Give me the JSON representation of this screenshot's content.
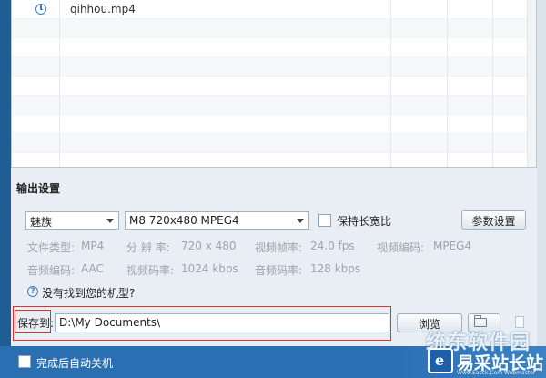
{
  "file_list": {
    "files": [
      {
        "name": "qihhou.mp4",
        "icon": "clock-icon"
      }
    ]
  },
  "output_settings": {
    "title": "输出设置",
    "device_brand": "魅族",
    "format": "M8 720x480 MPEG4",
    "keep_ratio_label": "保持长宽比",
    "keep_ratio_checked": false,
    "params_button": "参数设置",
    "info": {
      "file_type_label": "文件类型:",
      "file_type_value": "MP4",
      "resolution_label": "分 辨 率:",
      "resolution_value": "720 x 480",
      "frame_rate_label": "视频帧率:",
      "frame_rate_value": "24.0 fps",
      "video_codec_label": "视频编码:",
      "video_codec_value": "MPEG4",
      "audio_codec_label": "音频编码:",
      "audio_codec_value": "AAC",
      "video_bitrate_label": "视频码率:",
      "video_bitrate_value": "1024 kbps",
      "audio_bitrate_label": "音频码率:",
      "audio_bitrate_value": "128 kbps"
    },
    "missing_model_link": "没有找到您的机型?"
  },
  "save": {
    "label": "保存到:",
    "path": "D:\\My Documents\\",
    "browse_button": "浏览"
  },
  "footer": {
    "shutdown_label": "完成后自动关机",
    "shutdown_checked": false
  },
  "watermark": {
    "top_text": "统东软件园",
    "main_text": "易采站长站",
    "url_text": "Www.Easck.Com Webmaster"
  },
  "colors": {
    "accent": "#2a6fb1",
    "highlight_border": "#dd3333"
  }
}
